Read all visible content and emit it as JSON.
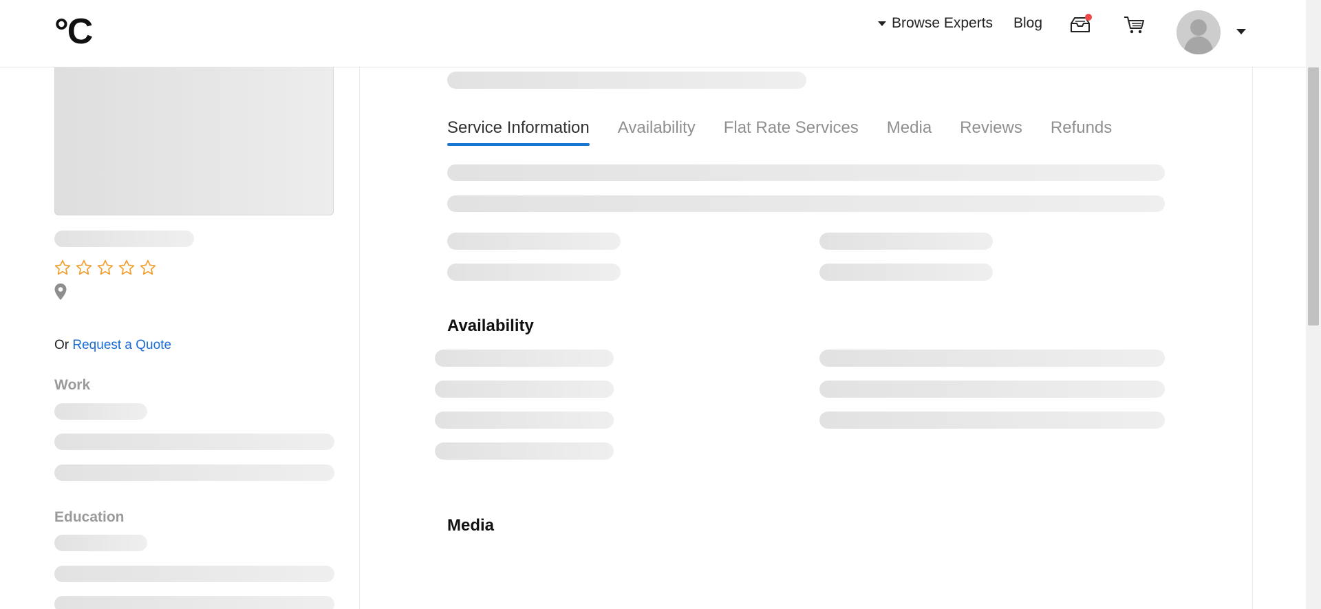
{
  "header": {
    "logo": "°C",
    "browse_label": "Browse Experts",
    "blog_label": "Blog"
  },
  "sidebar": {
    "quote_prefix": "Or ",
    "quote_link": "Request a Quote",
    "work_label": "Work",
    "education_label": "Education",
    "rating_stars": 5,
    "rating_value": 0
  },
  "tabs": [
    {
      "label": "Service Information",
      "active": true
    },
    {
      "label": "Availability",
      "active": false
    },
    {
      "label": "Flat Rate Services",
      "active": false
    },
    {
      "label": "Media",
      "active": false
    },
    {
      "label": "Reviews",
      "active": false
    },
    {
      "label": "Refunds",
      "active": false
    }
  ],
  "sections": {
    "availability_heading": "Availability",
    "media_heading": "Media"
  },
  "colors": {
    "accent": "#1976d2",
    "link": "#1a6bd6",
    "star": "#f0a030",
    "notification": "#ef4848"
  }
}
